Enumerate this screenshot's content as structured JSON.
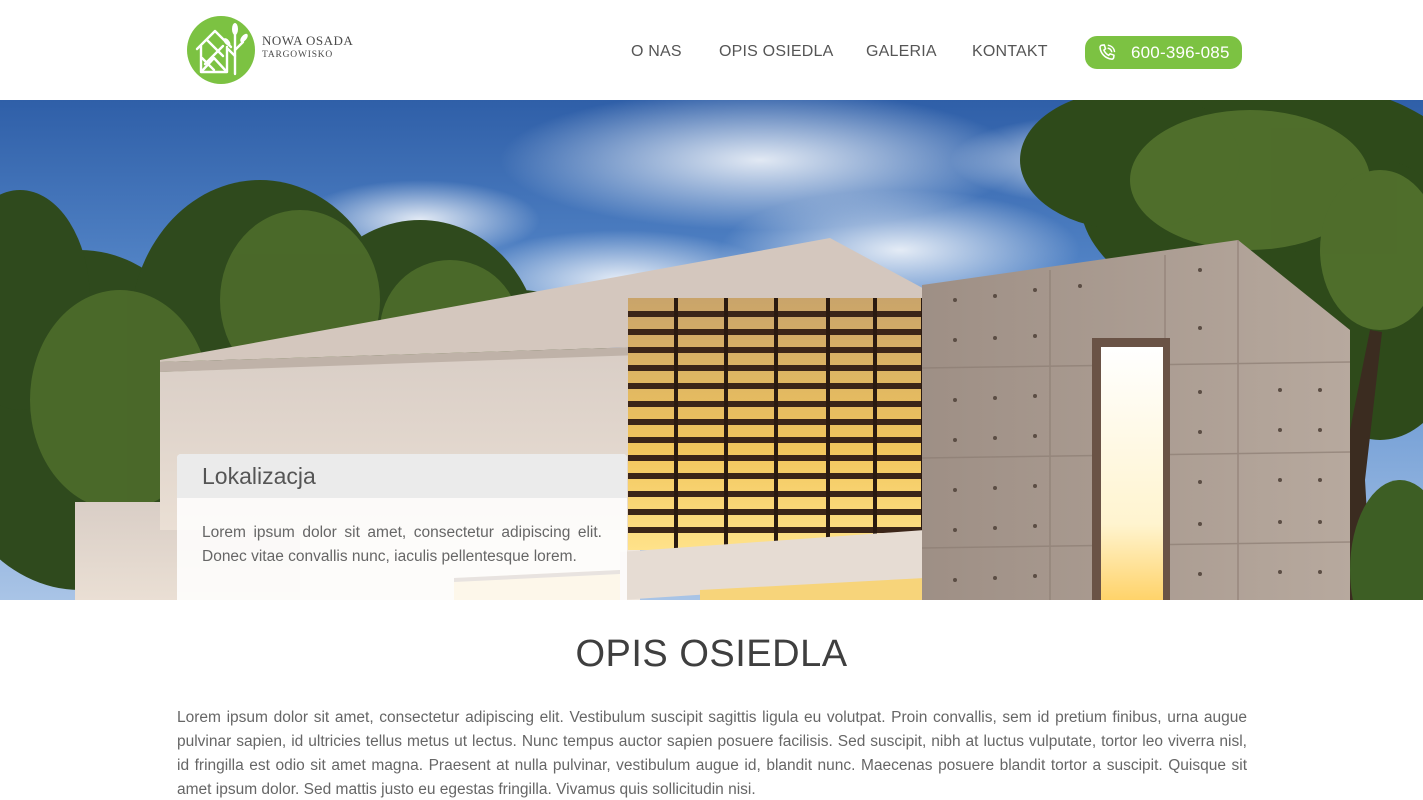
{
  "brand": {
    "name_line1": "NOWA OSADA",
    "name_line2": "TARGOWISKO",
    "accent_color": "#7cc242",
    "logo_icon": "house-tree-logo-icon"
  },
  "nav": {
    "items": [
      {
        "label": "O NAS"
      },
      {
        "label": "OPIS OSIEDLA"
      },
      {
        "label": "GALERIA"
      },
      {
        "label": "KONTAKT"
      }
    ],
    "phone": {
      "icon": "phone-icon",
      "number": "600-396-085"
    }
  },
  "hero": {
    "image_subject": "modern-house-photo",
    "card": {
      "title": "Lokalizacja",
      "text": "Lorem ipsum dolor sit amet, consectetur adipiscing elit. Donec vitae convallis nunc, iaculis pellentesque lorem."
    }
  },
  "section": {
    "title": "OPIS OSIEDLA",
    "text": "Lorem ipsum dolor sit amet, consectetur adipiscing elit. Vestibulum suscipit sagittis ligula eu volutpat. Proin convallis, sem id pretium finibus, urna augue pulvinar sapien, id ultricies tellus metus ut lectus. Nunc tempus auctor sapien posuere facilisis. Sed suscipit, nibh at luctus vulputate, tortor leo viverra nisl, id fringilla est odio sit amet magna. Praesent at nulla pulvinar, vestibulum augue id, blandit nunc. Maecenas posuere blandit tortor a suscipit. Quisque sit amet ipsum dolor. Sed mattis justo eu egestas fringilla. Vivamus quis sollicitudin nisi."
  }
}
